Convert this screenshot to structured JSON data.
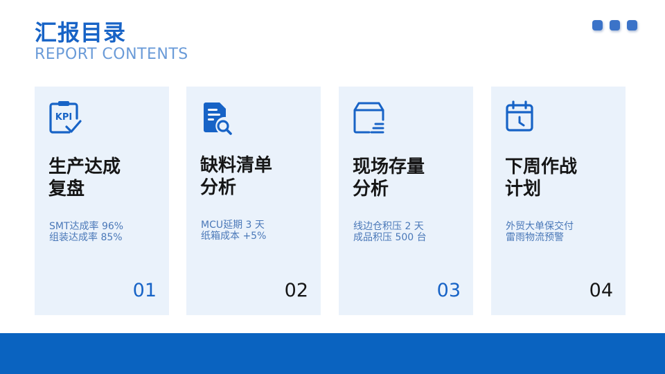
{
  "header": {
    "title": "汇报目录",
    "subtitle": "REPORT CONTENTS"
  },
  "colors": {
    "accent": "#1763c6",
    "card_bg": "#eaf2fb",
    "footer": "#0a63c0"
  },
  "cards": [
    {
      "icon": "kpi-clipboard-icon",
      "title_lines": [
        "生产达成",
        "复盘"
      ],
      "desc_lines": [
        "SMT达成率 96%",
        "组装达成率 85%"
      ],
      "number": "01"
    },
    {
      "icon": "document-search-icon",
      "title_lines": [
        "缺料清单",
        "分析"
      ],
      "desc_lines": [
        "MCU延期 3 天",
        "纸箱成本 +5%"
      ],
      "number": "02"
    },
    {
      "icon": "inventory-box-icon",
      "title_lines": [
        "现场存量",
        "分析"
      ],
      "desc_lines": [
        "线边仓积压 2 天",
        "成品积压 500 台"
      ],
      "number": "03"
    },
    {
      "icon": "calendar-clock-icon",
      "title_lines": [
        "下周作战",
        "计划"
      ],
      "desc_lines": [
        "外贸大单保交付",
        "雷雨物流预警"
      ],
      "number": "04"
    }
  ]
}
